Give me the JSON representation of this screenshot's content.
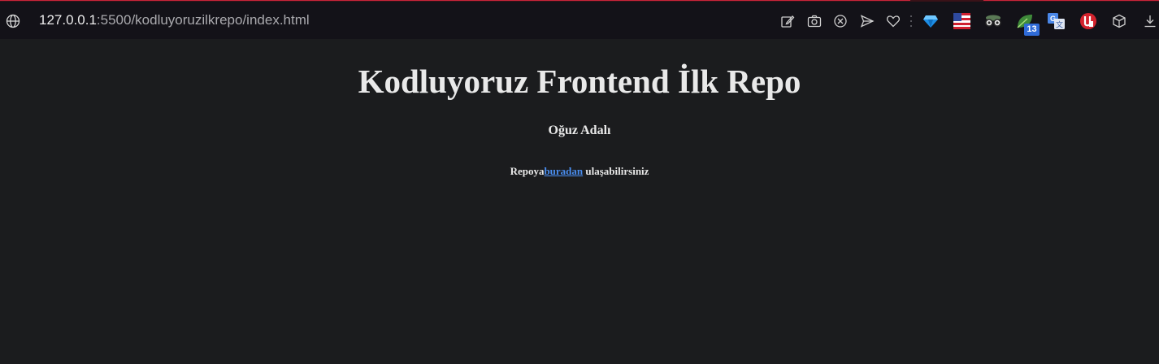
{
  "browser": {
    "url_host": "127.0.0.1",
    "url_path": ":5500/kodluyoruzilkrepo/index.html",
    "extension_badge": "13",
    "toolbar_icons": [
      "edit-page-icon",
      "screenshot-icon",
      "close-circle-icon",
      "send-icon",
      "heart-icon",
      "diamond-extension-icon",
      "us-flag-extension-icon",
      "spy-extension-icon",
      "leaf-extension-icon",
      "translate-extension-icon",
      "ublock-extension-icon",
      "cube-extension-icon",
      "download-icon"
    ],
    "accent_color": "#c8243a"
  },
  "page": {
    "title": "Kodluyoruz Frontend İlk Repo",
    "author": "Oğuz Adalı",
    "repo_prefix": "Repoya",
    "repo_link": "buradan",
    "repo_suffix": " ulaşabilirsiniz",
    "link_color": "#4a8ef0",
    "background": "#1b1c1e"
  }
}
